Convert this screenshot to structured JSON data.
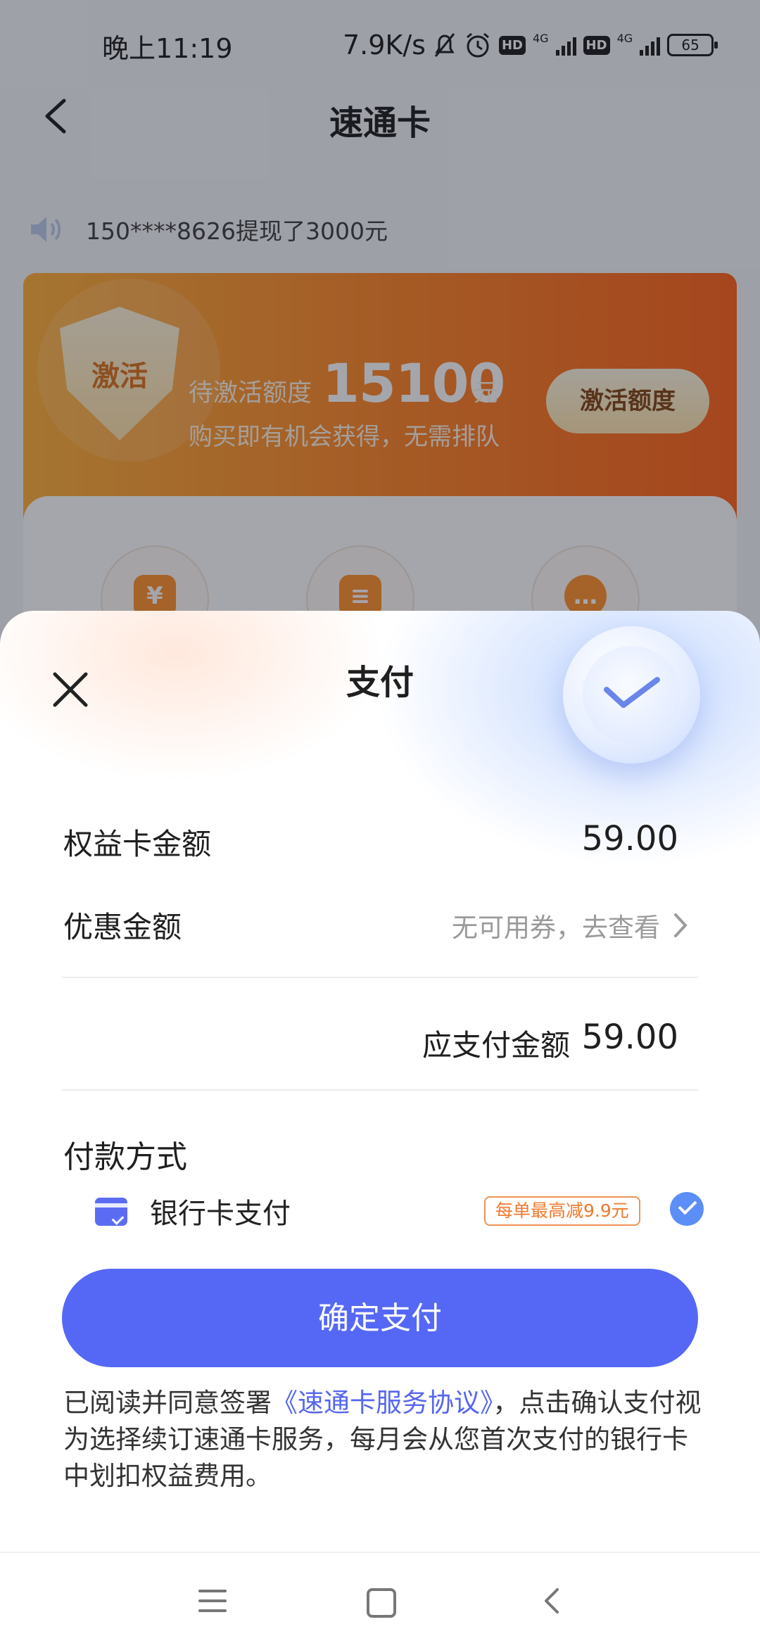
{
  "status_bar": {
    "time": "晚上11:19",
    "net_speed": "7.9K/s",
    "battery": "65"
  },
  "header": {
    "title": "速通卡"
  },
  "notice": {
    "text": "150****8626提现了3000元"
  },
  "promo": {
    "shield_label": "激活",
    "pending_label": "待激活额度",
    "amount": "15100",
    "unit": "元",
    "subtitle": "购买即有机会获得，无需排队",
    "activate_button": "激活额度"
  },
  "sheet": {
    "title": "支付",
    "card_amount_label": "权益卡金额",
    "card_amount_value": "59.00",
    "discount_label": "优惠金额",
    "discount_value": "无可用券，去查看",
    "payable_label": "应支付金额",
    "payable_value": "59.00",
    "payment_method_label": "付款方式",
    "bank_card_label": "银行卡支付",
    "bank_card_badge": "每单最高减9.9元",
    "bank_card_selected": true,
    "confirm_button": "确定支付",
    "agreement_prefix": "已阅读并同意签署",
    "agreement_link": "《速通卡服务协议》",
    "agreement_suffix": "，点击确认支付视为选择续订速通卡服务，每月会从您首次支付的银行卡中划扣权益费用。"
  },
  "colors": {
    "primary": "#5568f5",
    "promo_orange": "#ff7b18",
    "badge_orange": "#ef7a2f",
    "check_blue": "#5b8ef6"
  }
}
